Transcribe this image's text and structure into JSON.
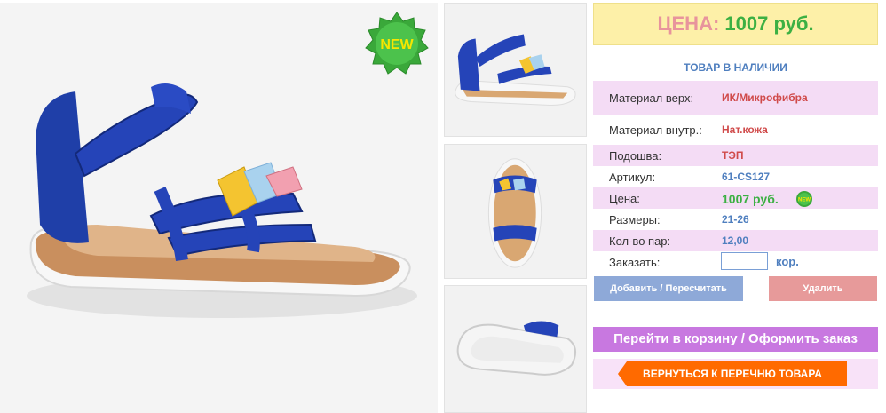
{
  "badges": {
    "new_label": "NEW",
    "mini_new_label": "NEW"
  },
  "price_box": {
    "label": "ЦЕНА:",
    "value": "1007 руб."
  },
  "stock_status": "ТОВАР В НАЛИЧИИ",
  "specs": [
    {
      "label": "Материал верх:",
      "value": "ИК/Микрофибра"
    },
    {
      "label": "Материал внутр.:",
      "value": "Нат.кожа"
    },
    {
      "label": "Подошва:",
      "value": "ТЭП"
    },
    {
      "label": "Артикул:",
      "value": "61-CS127"
    },
    {
      "label": "Цена:",
      "value": "1007 руб."
    },
    {
      "label": "Размеры:",
      "value": "21-26"
    },
    {
      "label": "Кол-во пар:",
      "value": "12,00"
    }
  ],
  "order": {
    "label": "Заказать:",
    "value": "",
    "unit": "кор."
  },
  "buttons": {
    "add": "Добавить / Пересчитать",
    "delete": "Удалить",
    "cart": "Перейти в корзину / Оформить заказ",
    "back": "ВЕРНУТЬСЯ К ПЕРЕЧНЮ ТОВАРА"
  },
  "colors": {
    "accent_blue": "#4f7fbf",
    "price_green": "#3cb043",
    "cart_purple": "#c878e0",
    "back_orange": "#ff6a00"
  }
}
